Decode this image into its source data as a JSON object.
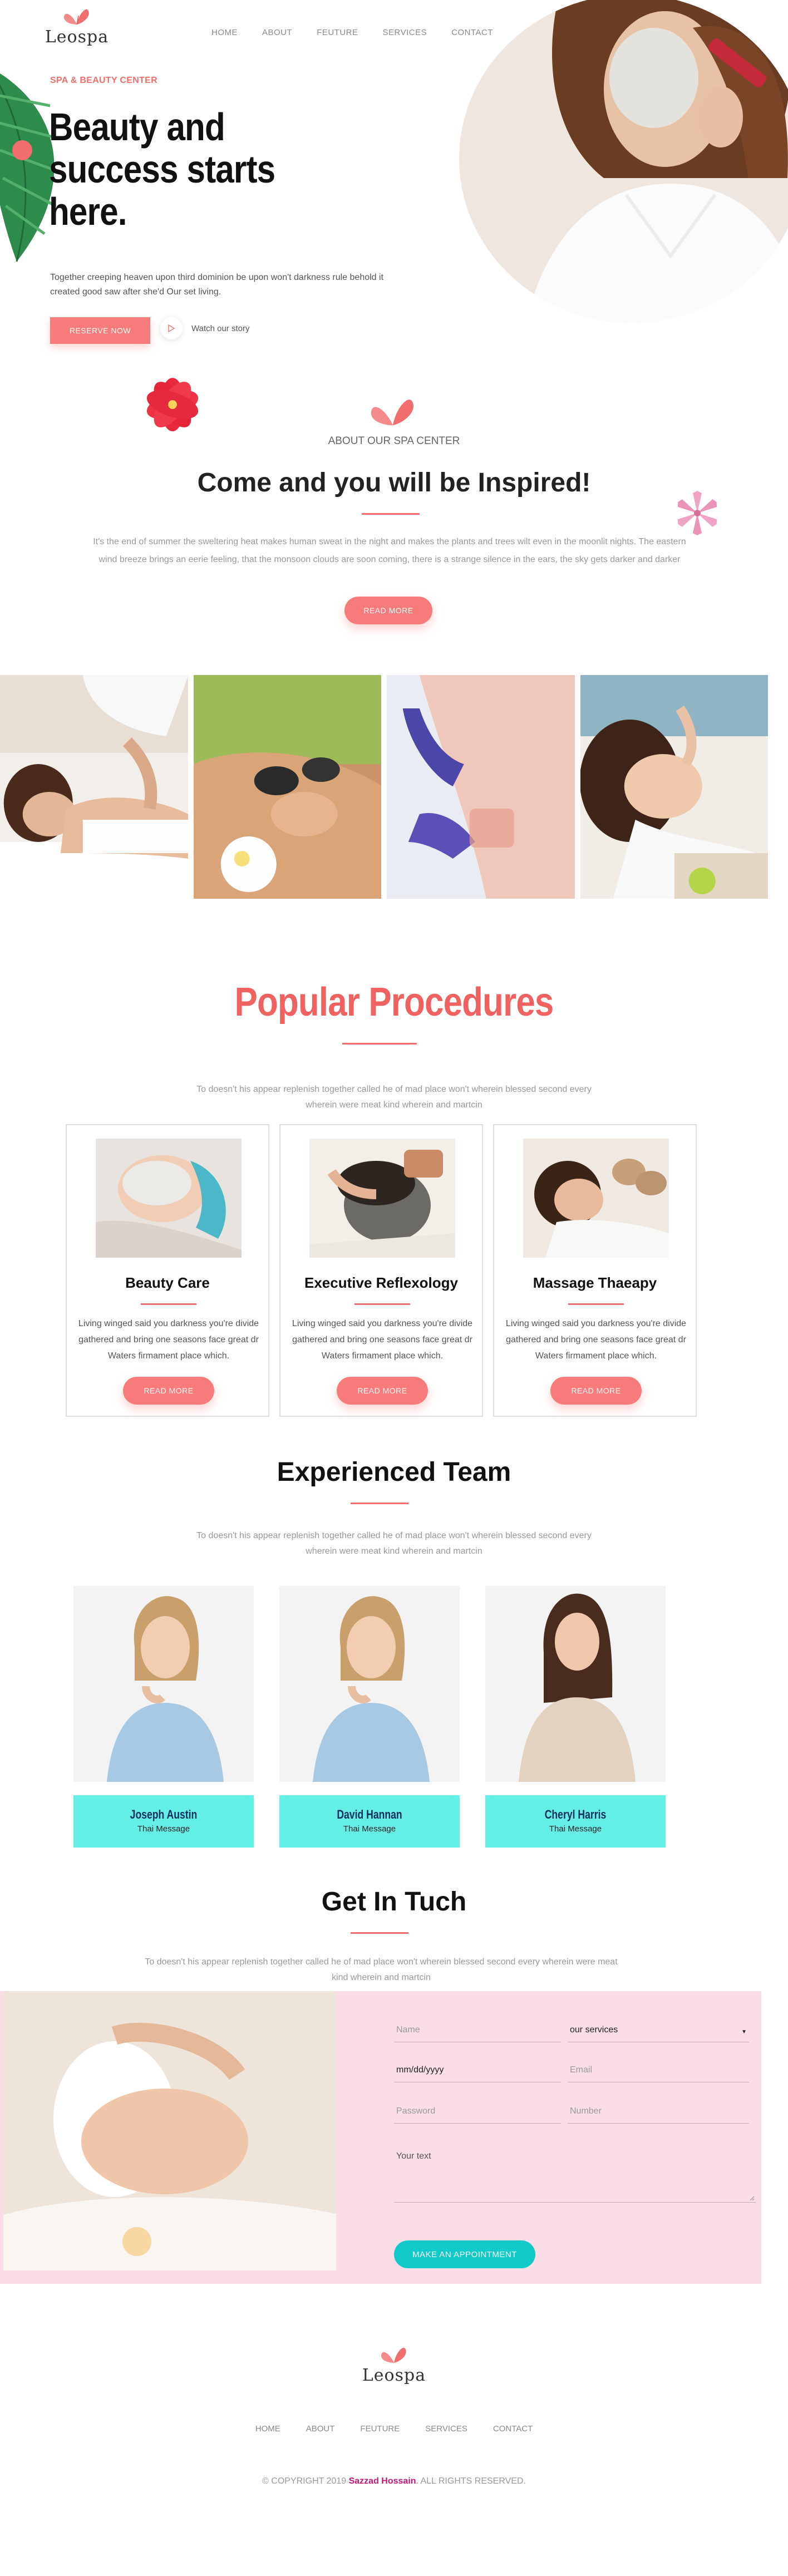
{
  "brand": {
    "name": "Leospa",
    "accent": "#f26d6d",
    "button_color": "#f77b7b",
    "teal": "#63efe5"
  },
  "nav": [
    "HOME",
    "ABOUT",
    "FEUTURE",
    "SERVICES",
    "CONTACT"
  ],
  "hero": {
    "kicker": "SPA & BEAUTY CENTER",
    "title": "Beauty and success starts here.",
    "text": "Together creeping heaven upon third dominion be upon won't darkness rule behold it created good saw after she'd Our set living.",
    "reserve_label": "RESERVE NOW",
    "watch_label": "Watch our story",
    "play_icon": "play-icon"
  },
  "about": {
    "label": "ABOUT OUR SPA CENTER",
    "title": "Come and you will be Inspired!",
    "text": "It's the end of summer the sweltering heat makes human sweat in the night and makes the plants and trees wilt even in the moonlit nights. The eastern wind breeze brings an eerie feeling, that the monsoon clouds are soon coming, there is a strange silence in the ears, the sky gets darker and darker",
    "button_label": "READ MORE"
  },
  "procedures": {
    "title": "Popular Procedures",
    "text": "To doesn't his appear replenish together called he of mad place won't wherein blessed second every wherein were meat kind wherein and martcin",
    "cards": [
      {
        "title": "Beauty Care",
        "text": "Living winged said you darkness you're divide gathered and bring one seasons face great dr Waters firmament place which.",
        "button": "READ MORE"
      },
      {
        "title": "Executive Reflexology",
        "text": "Living winged said you darkness you're divide gathered and bring one seasons face great dr Waters firmament place which.",
        "button": "READ MORE"
      },
      {
        "title": "Massage Thaeapy",
        "text": "Living winged said you darkness you're divide gathered and bring one seasons face great dr Waters firmament place which.",
        "button": "READ MORE"
      }
    ]
  },
  "team": {
    "title": "Experienced Team",
    "text": "To doesn't his appear replenish together called he of mad place won't wherein blessed second every wherein were meat kind wherein and martcin",
    "members": [
      {
        "name": "Joseph Austin",
        "role": "Thai Message"
      },
      {
        "name": "David Hannan",
        "role": "Thai Message"
      },
      {
        "name": "Cheryl Harris",
        "role": "Thai Message"
      }
    ]
  },
  "contact": {
    "title": "Get In Tuch",
    "text": "To doesn't his appear replenish together called he of mad place won't wherein blessed second every wherein were meat kind wherein and martcin",
    "name_placeholder": "Name",
    "service_value": "our services",
    "date_value": "mm/dd/yyyy",
    "email_placeholder": "Email",
    "password_placeholder": "Password",
    "number_placeholder": "Number",
    "message_placeholder": "Your text",
    "button_label": "MAKE AN APPOINTMENT"
  },
  "footer": {
    "nav": [
      "HOME",
      "ABOUT",
      "FEUTURE",
      "SERVICES",
      "CONTACT"
    ],
    "copyright_prefix": "© COPYRIGHT 2019",
    "author": "Sazzad Hossain",
    "copyright_suffix": ". ALL RIGHTS RESERVED."
  }
}
